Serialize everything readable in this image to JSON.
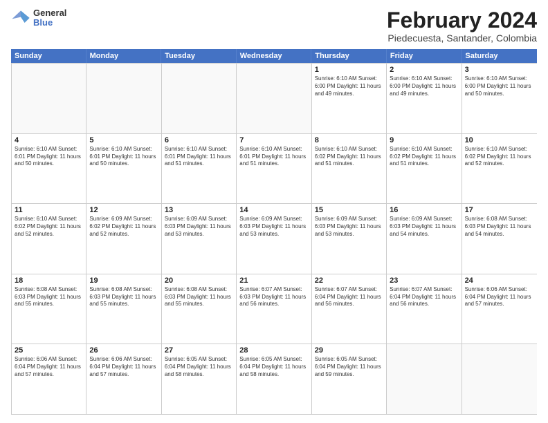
{
  "logo": {
    "general": "General",
    "blue": "Blue"
  },
  "header": {
    "month_year": "February 2024",
    "location": "Piedecuesta, Santander, Colombia"
  },
  "days_of_week": [
    "Sunday",
    "Monday",
    "Tuesday",
    "Wednesday",
    "Thursday",
    "Friday",
    "Saturday"
  ],
  "weeks": [
    [
      {
        "day": "",
        "info": ""
      },
      {
        "day": "",
        "info": ""
      },
      {
        "day": "",
        "info": ""
      },
      {
        "day": "",
        "info": ""
      },
      {
        "day": "1",
        "info": "Sunrise: 6:10 AM\nSunset: 6:00 PM\nDaylight: 11 hours\nand 49 minutes."
      },
      {
        "day": "2",
        "info": "Sunrise: 6:10 AM\nSunset: 6:00 PM\nDaylight: 11 hours\nand 49 minutes."
      },
      {
        "day": "3",
        "info": "Sunrise: 6:10 AM\nSunset: 6:00 PM\nDaylight: 11 hours\nand 50 minutes."
      }
    ],
    [
      {
        "day": "4",
        "info": "Sunrise: 6:10 AM\nSunset: 6:01 PM\nDaylight: 11 hours\nand 50 minutes."
      },
      {
        "day": "5",
        "info": "Sunrise: 6:10 AM\nSunset: 6:01 PM\nDaylight: 11 hours\nand 50 minutes."
      },
      {
        "day": "6",
        "info": "Sunrise: 6:10 AM\nSunset: 6:01 PM\nDaylight: 11 hours\nand 51 minutes."
      },
      {
        "day": "7",
        "info": "Sunrise: 6:10 AM\nSunset: 6:01 PM\nDaylight: 11 hours\nand 51 minutes."
      },
      {
        "day": "8",
        "info": "Sunrise: 6:10 AM\nSunset: 6:02 PM\nDaylight: 11 hours\nand 51 minutes."
      },
      {
        "day": "9",
        "info": "Sunrise: 6:10 AM\nSunset: 6:02 PM\nDaylight: 11 hours\nand 51 minutes."
      },
      {
        "day": "10",
        "info": "Sunrise: 6:10 AM\nSunset: 6:02 PM\nDaylight: 11 hours\nand 52 minutes."
      }
    ],
    [
      {
        "day": "11",
        "info": "Sunrise: 6:10 AM\nSunset: 6:02 PM\nDaylight: 11 hours\nand 52 minutes."
      },
      {
        "day": "12",
        "info": "Sunrise: 6:09 AM\nSunset: 6:02 PM\nDaylight: 11 hours\nand 52 minutes."
      },
      {
        "day": "13",
        "info": "Sunrise: 6:09 AM\nSunset: 6:03 PM\nDaylight: 11 hours\nand 53 minutes."
      },
      {
        "day": "14",
        "info": "Sunrise: 6:09 AM\nSunset: 6:03 PM\nDaylight: 11 hours\nand 53 minutes."
      },
      {
        "day": "15",
        "info": "Sunrise: 6:09 AM\nSunset: 6:03 PM\nDaylight: 11 hours\nand 53 minutes."
      },
      {
        "day": "16",
        "info": "Sunrise: 6:09 AM\nSunset: 6:03 PM\nDaylight: 11 hours\nand 54 minutes."
      },
      {
        "day": "17",
        "info": "Sunrise: 6:08 AM\nSunset: 6:03 PM\nDaylight: 11 hours\nand 54 minutes."
      }
    ],
    [
      {
        "day": "18",
        "info": "Sunrise: 6:08 AM\nSunset: 6:03 PM\nDaylight: 11 hours\nand 55 minutes."
      },
      {
        "day": "19",
        "info": "Sunrise: 6:08 AM\nSunset: 6:03 PM\nDaylight: 11 hours\nand 55 minutes."
      },
      {
        "day": "20",
        "info": "Sunrise: 6:08 AM\nSunset: 6:03 PM\nDaylight: 11 hours\nand 55 minutes."
      },
      {
        "day": "21",
        "info": "Sunrise: 6:07 AM\nSunset: 6:03 PM\nDaylight: 11 hours\nand 56 minutes."
      },
      {
        "day": "22",
        "info": "Sunrise: 6:07 AM\nSunset: 6:04 PM\nDaylight: 11 hours\nand 56 minutes."
      },
      {
        "day": "23",
        "info": "Sunrise: 6:07 AM\nSunset: 6:04 PM\nDaylight: 11 hours\nand 56 minutes."
      },
      {
        "day": "24",
        "info": "Sunrise: 6:06 AM\nSunset: 6:04 PM\nDaylight: 11 hours\nand 57 minutes."
      }
    ],
    [
      {
        "day": "25",
        "info": "Sunrise: 6:06 AM\nSunset: 6:04 PM\nDaylight: 11 hours\nand 57 minutes."
      },
      {
        "day": "26",
        "info": "Sunrise: 6:06 AM\nSunset: 6:04 PM\nDaylight: 11 hours\nand 57 minutes."
      },
      {
        "day": "27",
        "info": "Sunrise: 6:05 AM\nSunset: 6:04 PM\nDaylight: 11 hours\nand 58 minutes."
      },
      {
        "day": "28",
        "info": "Sunrise: 6:05 AM\nSunset: 6:04 PM\nDaylight: 11 hours\nand 58 minutes."
      },
      {
        "day": "29",
        "info": "Sunrise: 6:05 AM\nSunset: 6:04 PM\nDaylight: 11 hours\nand 59 minutes."
      },
      {
        "day": "",
        "info": ""
      },
      {
        "day": "",
        "info": ""
      }
    ]
  ]
}
